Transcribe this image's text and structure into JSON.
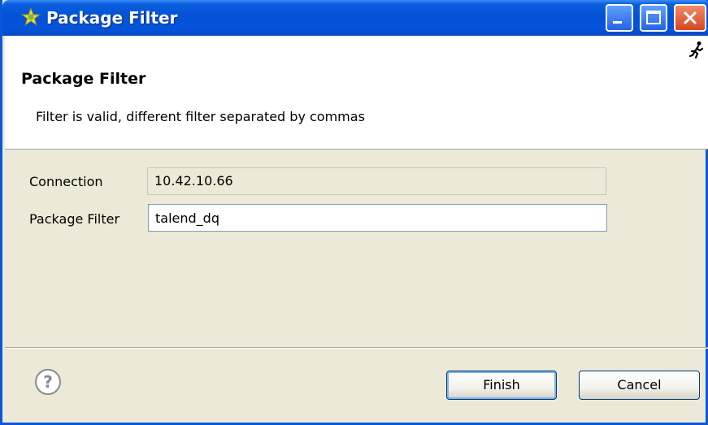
{
  "window": {
    "title": "Package Filter",
    "icons": {
      "app": "star-gear-icon",
      "minimize": "minimize-icon",
      "maximize": "maximize-icon",
      "close": "close-icon"
    }
  },
  "header": {
    "title": "Package Filter",
    "message": "Filter is valid, different filter separated by commas",
    "icon": "running-man-icon"
  },
  "form": {
    "connection_label": "Connection",
    "connection_value": "10.42.10.66",
    "package_filter_label": "Package Filter",
    "package_filter_value": "talend_dq"
  },
  "footer": {
    "help_icon": "help-icon",
    "finish_label": "Finish",
    "cancel_label": "Cancel"
  },
  "colors": {
    "titlebar": "#0451d6",
    "dialog_bg": "#ece9d8",
    "close_button": "#d7471f"
  }
}
